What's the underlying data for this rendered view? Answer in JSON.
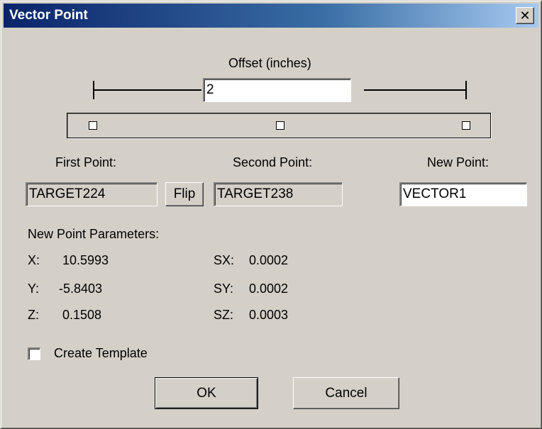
{
  "window": {
    "title": "Vector Point",
    "close_symbol": "✕"
  },
  "offset": {
    "label": "Offset (inches)",
    "value": "2"
  },
  "points": {
    "first_label": "First Point:",
    "first_value": "TARGET224",
    "flip_label": "Flip",
    "second_label": "Second Point:",
    "second_value": "TARGET238",
    "new_label": "New Point:",
    "new_value": "VECTOR1"
  },
  "params": {
    "heading": "New Point Parameters:",
    "x_label": "X:",
    "x_value": "10.5993",
    "y_label": "Y:",
    "y_value": "-5.8403",
    "z_label": "Z:",
    "z_value": "0.1508",
    "sx_label": "SX:",
    "sx_value": "0.0002",
    "sy_label": "SY:",
    "sy_value": "0.0002",
    "sz_label": "SZ:",
    "sz_value": "0.0003"
  },
  "create_template": {
    "label": "Create Template",
    "checked": false
  },
  "buttons": {
    "ok": "OK",
    "cancel": "Cancel"
  }
}
